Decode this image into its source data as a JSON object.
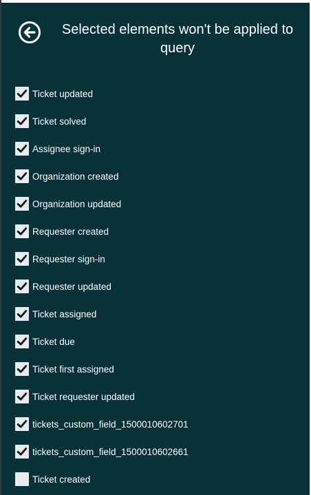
{
  "header": {
    "title": "Selected elements won't be applied to query",
    "back_icon": "arrow-left-circle-icon"
  },
  "colors": {
    "panel_background": "#063238",
    "checkbox_fill": "#e8eaeb",
    "check_mark": "#0b1a1d",
    "text": "#ffffff"
  },
  "items": [
    {
      "label": "Ticket updated",
      "checked": true
    },
    {
      "label": "Ticket solved",
      "checked": true
    },
    {
      "label": "Assignee sign-in",
      "checked": true
    },
    {
      "label": "Organization created",
      "checked": true
    },
    {
      "label": "Organization updated",
      "checked": true
    },
    {
      "label": "Requester created",
      "checked": true
    },
    {
      "label": "Requester sign-in",
      "checked": true
    },
    {
      "label": "Requester updated",
      "checked": true
    },
    {
      "label": "Ticket assigned",
      "checked": true
    },
    {
      "label": "Ticket due",
      "checked": true
    },
    {
      "label": "Ticket first assigned",
      "checked": true
    },
    {
      "label": "Ticket requester updated",
      "checked": true
    },
    {
      "label": "tickets_custom_field_1500010602701",
      "checked": true
    },
    {
      "label": "tickets_custom_field_1500010602661",
      "checked": true
    },
    {
      "label": "Ticket created",
      "checked": false
    }
  ]
}
